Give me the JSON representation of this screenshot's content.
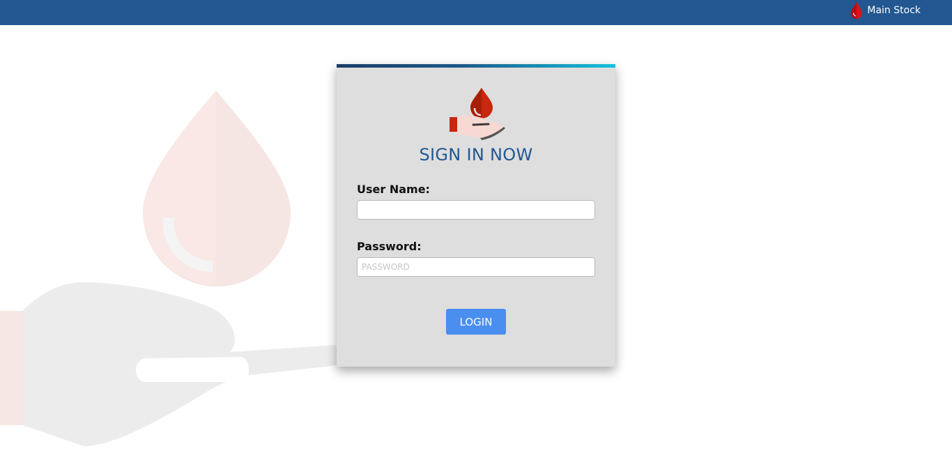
{
  "topbar": {
    "link_label": "Main Stock",
    "link_icon": "blood-drop-icon",
    "background_color": "#225791"
  },
  "login_card": {
    "logo_icon": "hand-blood-drop-icon",
    "title": "SIGN IN NOW",
    "username": {
      "label": "User Name:",
      "value": "",
      "placeholder": ""
    },
    "password": {
      "label": "Password:",
      "value": "",
      "placeholder": "PASSWORD"
    },
    "submit_label": "LOGIN",
    "accent_color": "#225791",
    "button_color": "#4a8ef0"
  },
  "background_illustration": {
    "icon": "hand-blood-drop-watermark"
  }
}
